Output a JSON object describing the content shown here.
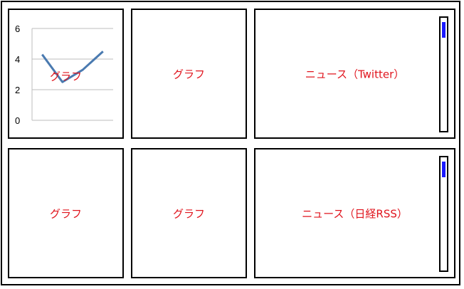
{
  "colors": {
    "label": "#e0141d",
    "line": "#4a7ab0",
    "grid": "#bdbdbd",
    "scroll_thumb": "#1a1aff"
  },
  "panels": [
    {
      "id": "panel-1",
      "label": "グラフ",
      "type": "chart"
    },
    {
      "id": "panel-2",
      "label": "グラフ"
    },
    {
      "id": "panel-3",
      "label": "ニュース（Twitter）",
      "scrollable": true
    },
    {
      "id": "panel-4",
      "label": "グラフ"
    },
    {
      "id": "panel-5",
      "label": "グラフ"
    },
    {
      "id": "panel-6",
      "label": "ニュース（日経RSS）",
      "scrollable": true
    }
  ],
  "chart_data": {
    "type": "line",
    "x": [
      1,
      2,
      3,
      4
    ],
    "series": [
      {
        "values": [
          4.3,
          2.5,
          3.3,
          4.5
        ]
      }
    ],
    "ylim": [
      0,
      6
    ],
    "yticks": [
      "0",
      "2",
      "4",
      "6"
    ],
    "grid": true,
    "legend": "none"
  }
}
